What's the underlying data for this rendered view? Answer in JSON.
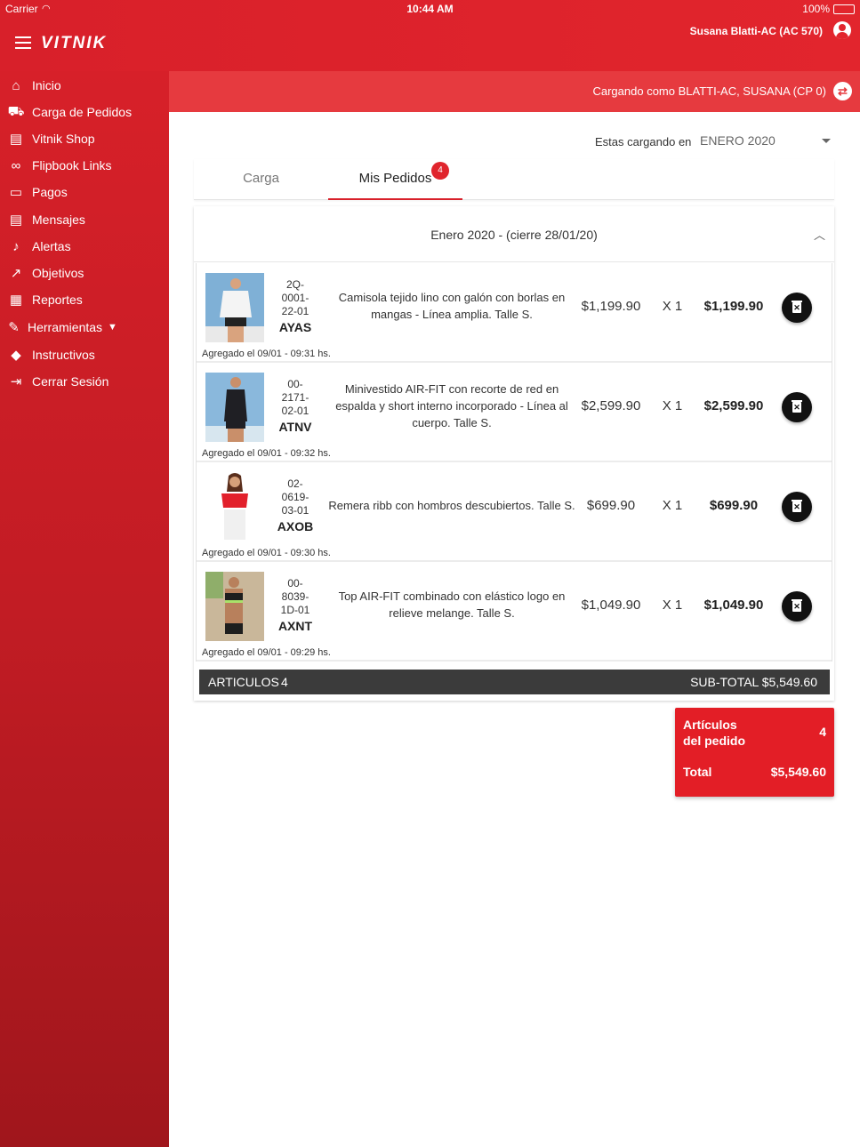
{
  "status_bar": {
    "carrier": "Carrier",
    "time": "10:44 AM",
    "battery": "100%"
  },
  "header": {
    "logo": "VITNIK",
    "user_name": "Susana Blatti-AC (AC 570)"
  },
  "sidebar": {
    "items": [
      {
        "label": "Inicio",
        "icon": "home-icon",
        "glyph": "⌂"
      },
      {
        "label": "Carga de Pedidos",
        "icon": "cart-icon",
        "glyph": "🛒"
      },
      {
        "label": "Vitnik Shop",
        "icon": "store-icon",
        "glyph": "▤"
      },
      {
        "label": "Flipbook Links",
        "icon": "link-icon",
        "glyph": "⊂⊃"
      },
      {
        "label": "Pagos",
        "icon": "credit-card-icon",
        "glyph": "▭"
      },
      {
        "label": "Mensajes",
        "icon": "message-icon",
        "glyph": "▤"
      },
      {
        "label": "Alertas",
        "icon": "bell-icon",
        "glyph": "🔔"
      },
      {
        "label": "Objetivos",
        "icon": "trending-up-icon",
        "glyph": "↗"
      },
      {
        "label": "Reportes",
        "icon": "clipboard-icon",
        "glyph": "▦"
      },
      {
        "label": "Herramientas",
        "icon": "wrench-icon",
        "glyph": "🔧"
      },
      {
        "label": "Instructivos",
        "icon": "graduation-cap-icon",
        "glyph": "🎓"
      },
      {
        "label": "Cerrar Sesión",
        "icon": "logout-icon",
        "glyph": "⇥"
      }
    ]
  },
  "subheader": {
    "loading_as": "Cargando como BLATTI-AC, SUSANA (CP 0)"
  },
  "period": {
    "label": "Estas cargando en",
    "selected": "ENERO 2020"
  },
  "tabs": {
    "carga": "Carga",
    "mis_pedidos": "Mis Pedidos",
    "badge_count": "4"
  },
  "order": {
    "month_title": "Enero 2020 - (cierre 28/01/20)",
    "items": [
      {
        "code": [
          "2Q-",
          "0001-",
          "22-01"
        ],
        "sku": "AYAS",
        "description": "Camisola tejido lino con galón con borlas en mangas - Línea amplia. Talle S.",
        "price": "$1,199.90",
        "qty": "X 1",
        "total": "$1,199.90",
        "added": "Agregado el 09/01 - 09:31 hs.",
        "colors": {
          "bg": "#7fb0d6",
          "top": "#f4f4f4",
          "bottom": "#222222",
          "skin": "#d9a37e"
        }
      },
      {
        "code": [
          "00-",
          "2171-",
          "02-01"
        ],
        "sku": "ATNV",
        "description": "Minivestido AIR-FIT con recorte de red en espalda y short interno incorporado - Línea al cuerpo. Talle S.",
        "price": "$2,599.90",
        "qty": "X 1",
        "total": "$2,599.90",
        "added": "Agregado el 09/01 - 09:32 hs.",
        "colors": {
          "bg": "#8ab8dc",
          "top": "#1f1f24",
          "bottom": "#1f1f24",
          "skin": "#c98f6a"
        }
      },
      {
        "code": [
          "02-",
          "0619-",
          "03-01"
        ],
        "sku": "AXOB",
        "description": "Remera ribb con hombros descubiertos. Talle S.",
        "price": "$699.90",
        "qty": "X 1",
        "total": "$699.90",
        "added": "Agregado el 09/01 - 09:30 hs.",
        "colors": {
          "bg": "#ffffff",
          "top": "#e2202b",
          "bottom": "#f0f0f0",
          "skin": "#d6a07a"
        }
      },
      {
        "code": [
          "00-",
          "8039-",
          "1D-01"
        ],
        "sku": "AXNT",
        "description": "Top AIR-FIT combinado con elástico logo en relieve melange. Talle S.",
        "price": "$1,049.90",
        "qty": "X 1",
        "total": "$1,049.90",
        "added": "Agregado el 09/01 - 09:29 hs.",
        "colors": {
          "bg": "#c9b79a",
          "top": "#1e1e1e",
          "bottom": "#1e1e1e",
          "skin": "#b8805c",
          "accent": "#a9e26a"
        }
      }
    ],
    "summary": {
      "articles_label": "ARTICULOS",
      "articles_count": "4",
      "subtotal": "SUB-TOTAL  $5,549.60"
    }
  },
  "totals": {
    "articles_label_1": "Artículos",
    "articles_label_2": "del pedido",
    "articles_count": "4",
    "total_label": "Total",
    "total_value": "$5,549.60"
  },
  "theme": {
    "primary": "#e2252d",
    "dark": "#3b3b3b"
  }
}
